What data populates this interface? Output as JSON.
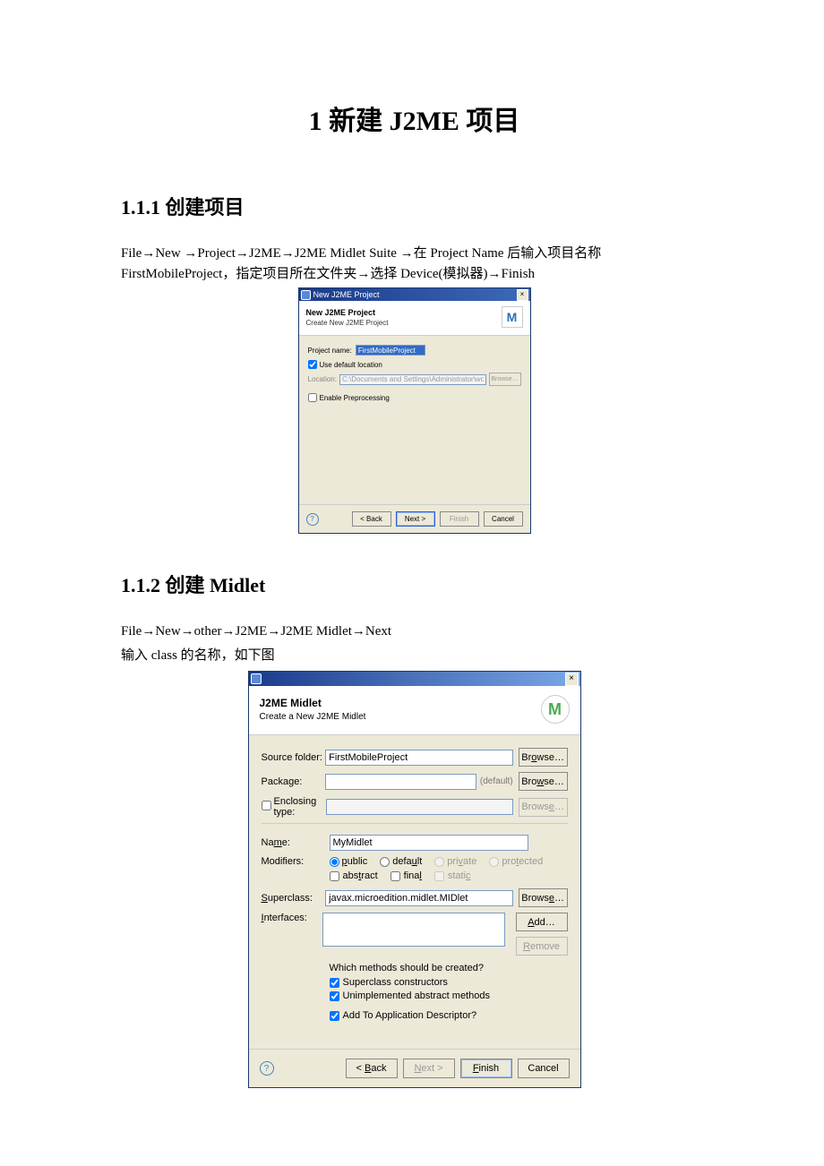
{
  "doc": {
    "title": "1 新建 J2ME 项目",
    "s1": {
      "heading": "1.1.1 创建项目",
      "para": "File→New  →Project→J2ME→J2ME  Midlet  Suite  →在 Project  Name 后输入项目名称FirstMobileProject，指定项目所在文件夹→选择 Device(模拟器)→Finish"
    },
    "s2": {
      "heading": "1.1.2 创建 Midlet",
      "para1": "File→New→other→J2ME→J2ME Midlet→Next",
      "para2": "输入 class 的名称，如下图"
    }
  },
  "dlg1": {
    "title": "New J2ME Project",
    "head_title": "New J2ME Project",
    "head_sub": "Create New J2ME Project",
    "banner": "M",
    "project_name_label": "Project name:",
    "project_name_value": "FirstMobileProject",
    "use_default_label": "Use default location",
    "location_label": "Location:",
    "location_value": "C:\\Documents and Settings\\Administrator\\workspace\\FirstMobilePro",
    "browse": "Browse…",
    "enable_pre": "Enable Preprocessing",
    "back": "< Back",
    "next": "Next >",
    "finish": "Finish",
    "cancel": "Cancel",
    "close": "×",
    "help": "?"
  },
  "dlg2": {
    "head_title": "J2ME Midlet",
    "head_sub": "Create a New J2ME Midlet",
    "banner": "M",
    "source_folder_label": "Source folder:",
    "source_folder_value": "FirstMobileProject",
    "package_label": "Package:",
    "package_value": "",
    "package_default": "(default)",
    "enclosing_label": "Enclosing type:",
    "name_label": "Name:",
    "name_value": "MyMidlet",
    "modifiers_label": "Modifiers:",
    "mod_public": "public",
    "mod_default": "default",
    "mod_private": "private",
    "mod_protected": "protected",
    "mod_abstract": "abstract",
    "mod_final": "final",
    "mod_static": "static",
    "superclass_label": "Superclass:",
    "superclass_value": "javax.microedition.midlet.MIDlet",
    "interfaces_label": "Interfaces:",
    "browse": "Browse…",
    "add": "Add…",
    "remove": "Remove",
    "methods_q": "Which methods should be created?",
    "methods_super": "Superclass constructors",
    "methods_unimpl": "Unimplemented abstract methods",
    "add_app_desc": "Add To Application Descriptor?",
    "back": "< Back",
    "next": "Next >",
    "finish": "Finish",
    "cancel": "Cancel",
    "close": "×",
    "help": "?"
  }
}
